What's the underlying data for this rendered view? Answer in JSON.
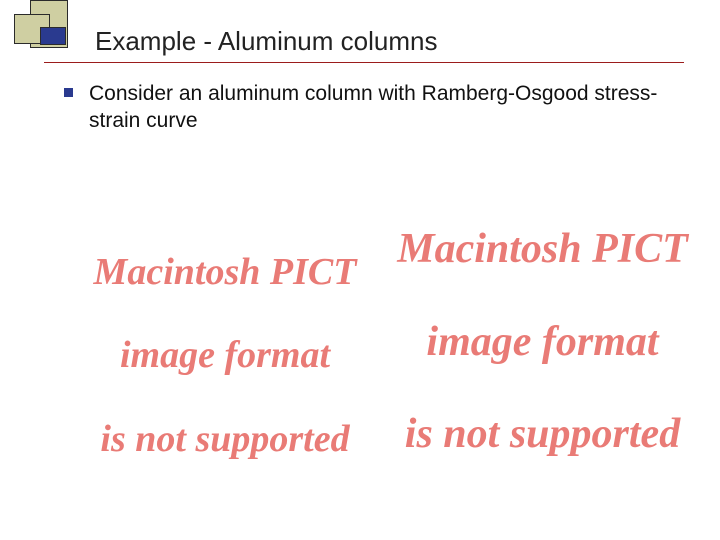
{
  "title": "Example - Aluminum columns",
  "bullet": "Consider an aluminum column with Ramberg-Osgood stress-strain curve",
  "placeholder": {
    "line1": "Macintosh PICT",
    "line2": "image format",
    "line3": "is not supported"
  }
}
